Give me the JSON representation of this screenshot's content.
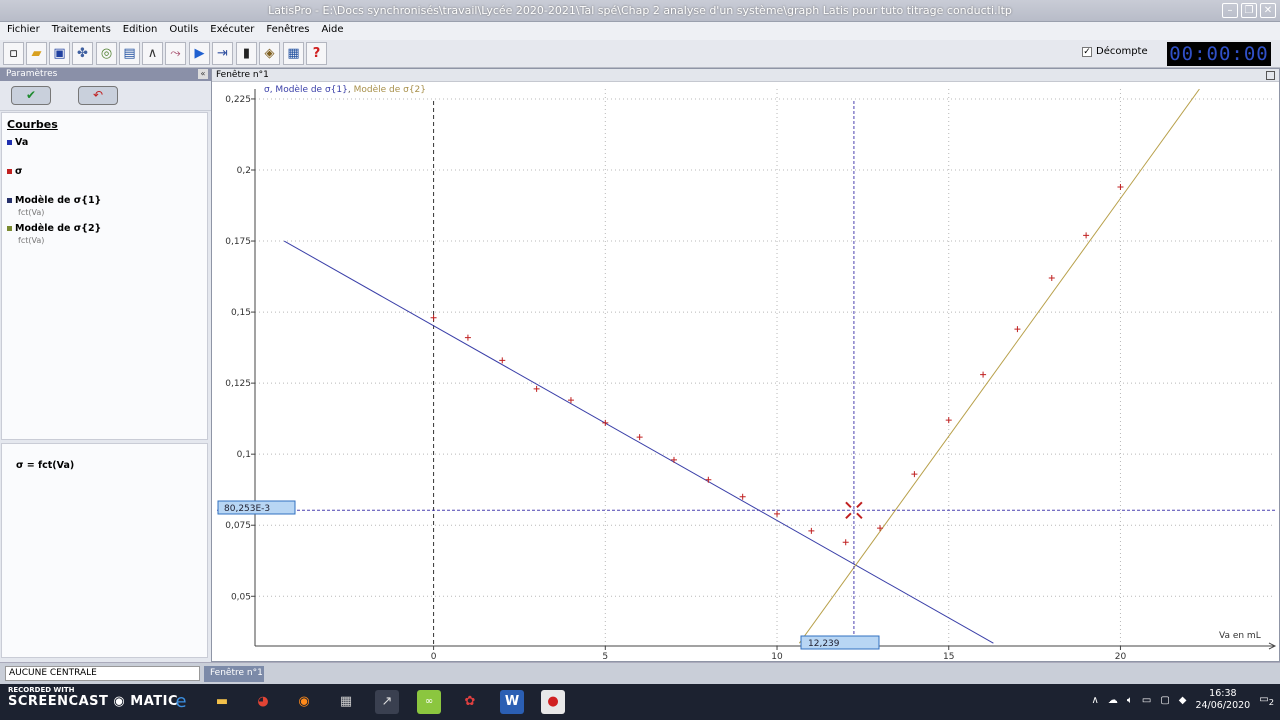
{
  "window": {
    "title": "LatisPro - E:\\Docs synchronisés\\travail\\Lycée 2020-2021\\Tal spé\\Chap 2 analyse d'un système\\graph Latis pour tuto titrage conducti.ltp"
  },
  "menu": [
    "Fichier",
    "Traitements",
    "Edition",
    "Outils",
    "Exécuter",
    "Fenêtres",
    "Aide"
  ],
  "toolbar": {
    "decompte_label": "Décompte",
    "decompte_checked": "✓",
    "timer": "00:00:00"
  },
  "left_panel": {
    "header": "Paramètres",
    "collapse": "«",
    "curves_title": "Courbes",
    "curves": [
      {
        "label": "Va",
        "color": "#1f2fb0",
        "sub": ""
      },
      {
        "label": "σ",
        "color": "#c02020",
        "sub": ""
      },
      {
        "label": "Modèle de σ{1}",
        "color": "#26306a",
        "sub": "fct(Va)"
      },
      {
        "label": "Modèle de σ{2}",
        "color": "#7a8a30",
        "sub": "fct(Va)"
      }
    ],
    "formula": "σ = fct(Va)"
  },
  "graph_window": {
    "title": "Fenêtre n°1",
    "legend": {
      "s1": "σ, Modèle de σ{1}",
      "sep": ", ",
      "s2": "Modèle de σ{2}"
    },
    "cursor_y_label": "80,253E-3",
    "cursor_x_label": "12,239",
    "x_axis_label": "Va en mL"
  },
  "chart_data": {
    "type": "scatter",
    "xlabel": "Va en mL",
    "xlim": [
      -5.2,
      24.5
    ],
    "ylim": [
      0.0325,
      0.2285
    ],
    "x_ticks": [
      0,
      5,
      10,
      15,
      20
    ],
    "y_ticks": [
      0.05,
      0.075,
      0.1,
      0.125,
      0.15,
      0.175,
      0.2,
      0.225
    ],
    "x_tick_labels": [
      "0",
      "5",
      "10",
      "15",
      "20"
    ],
    "y_tick_labels": [
      "0,05",
      "0,075",
      "0,1",
      "0,125",
      "0,15",
      "0,175",
      "0,2",
      "0,225"
    ],
    "grid": true,
    "series": [
      {
        "name": "σ",
        "color": "#c02020",
        "x": [
          0,
          1,
          2,
          3,
          4,
          5,
          6,
          7,
          8,
          9,
          10,
          11,
          12,
          13,
          14,
          15,
          16,
          17,
          18,
          19,
          20
        ],
        "y": [
          0.148,
          0.141,
          0.133,
          0.123,
          0.119,
          0.111,
          0.106,
          0.098,
          0.091,
          0.085,
          0.079,
          0.073,
          0.069,
          0.074,
          0.093,
          0.112,
          0.128,
          0.144,
          0.162,
          0.177,
          0.194
        ]
      },
      {
        "name": "Modèle de σ{1}",
        "color": "#3a3fa8",
        "x": [
          -4.35,
          16.3
        ],
        "y": [
          0.175,
          0.0335
        ]
      },
      {
        "name": "Modèle de σ{2}",
        "color": "#b8a04a",
        "x": [
          10.65,
          22.3
        ],
        "y": [
          0.0335,
          0.2285
        ]
      }
    ],
    "cursor": {
      "x": 12.239,
      "y": 0.080253
    }
  },
  "statusbar": {
    "left": "AUCUNE CENTRALE",
    "tab": "Fenêtre n°1"
  },
  "taskbar": {
    "watermark_top": "RECORDED WITH",
    "watermark_main": "SCREENCAST",
    "watermark_end": "MATIC",
    "time": "16:38",
    "date": "24/06/2020",
    "notif_count": "2"
  }
}
